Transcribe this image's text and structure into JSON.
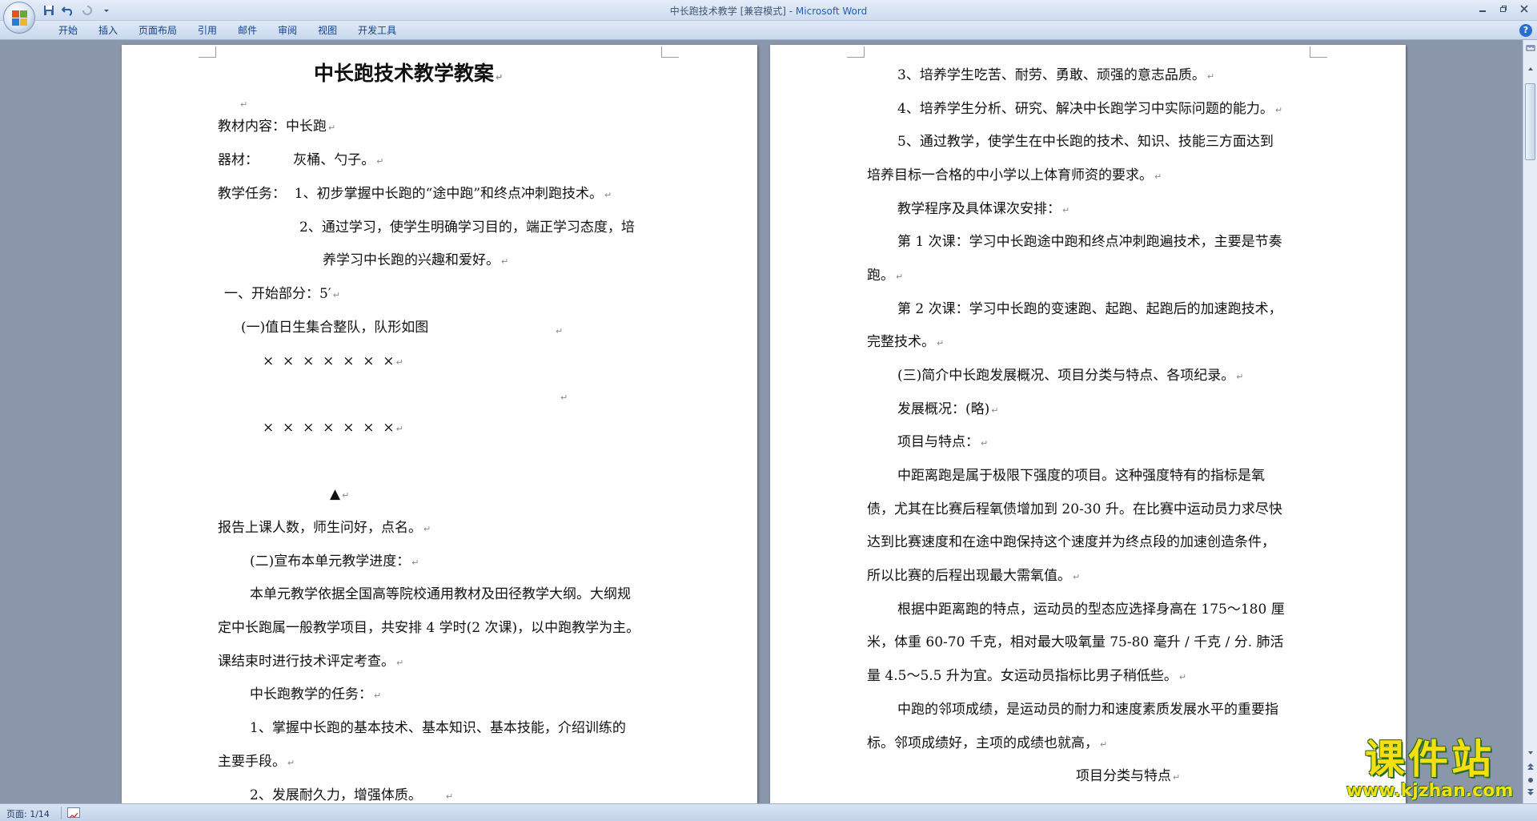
{
  "window": {
    "title_doc": "中长跑技术教学 [兼容模式] - ",
    "title_app": "Microsoft Word"
  },
  "quick_access": {
    "save_icon": "save-icon",
    "undo_icon": "undo-icon",
    "redo_icon": "redo-icon",
    "customize_icon": "dropdown-icon"
  },
  "ribbon": {
    "tabs": [
      "开始",
      "插入",
      "页面布局",
      "引用",
      "邮件",
      "审阅",
      "视图",
      "开发工具"
    ],
    "help": "?"
  },
  "left_page": {
    "title": "中长跑技术教学教案",
    "lines": [
      "教材内容：中长跑",
      "器材：        灰桶、勺子。",
      "教学任务：  1、初步掌握中长跑的“途中跑”和终点冲刺跑技术。",
      "2、通过学习，使学生明确学习目的，端正学习态度，培",
      "养学习中长跑的兴趣和爱好。",
      "一、开始部分：5′",
      "(一)值日生集合整队，队形如图",
      "×  ×  ×  ×  ×  ×  ×",
      "×  ×  ×  ×  ×  ×  ×",
      "▲",
      "报告上课人数，师生问好，点名。",
      "(二)宣布本单元教学进度：",
      "本单元教学依据全国高等院校通用教材及田径教学大纲。大纲规",
      "定中长跑属一般教学项目，共安排 4 学时(2 次课)，以中跑教学为主。",
      "课结束时进行技术评定考查。",
      "中长跑教学的任务：",
      "1、掌握中长跑的基本技术、基本知识、基本技能，介绍训练的",
      "主要手段。",
      "2、发展耐久力，增强体质。"
    ]
  },
  "right_page": {
    "lines": [
      "3、培养学生吃苦、耐劳、勇敢、顽强的意志品质。",
      "4、培养学生分析、研究、解决中长跑学习中实际问题的能力。",
      "5、通过教学，使学生在中长跑的技术、知识、技能三方面达到",
      "培养目标一合格的中小学以上体育师资的要求。",
      "教学程序及具体课次安排：",
      "第 1 次课：学习中长跑途中跑和终点冲刺跑遍技术，主要是节奏",
      "跑。",
      "第 2 次课：学习中长跑的变速跑、起跑、起跑后的加速跑技术，",
      "完整技术。",
      "(三)简介中长跑发展概况、项目分类与特点、各项纪录。",
      "发展概况：(略)",
      "项目与特点：",
      "中距离跑是属于极限下强度的项目。这种强度特有的指标是氧",
      "债，尤其在比赛后程氧债增加到 20-30 升。在比赛中运动员力求尽快",
      "达到比赛速度和在途中跑保持这个速度并为终点段的加速创造条件，",
      "所以比赛的后程出现最大需氧值。",
      "根据中距离跑的特点，运动员的型态应选择身高在 175～180 厘",
      "米，体重 60-70 千克，相对最大吸氧量 75-80 毫升 / 千克 / 分. 肺活",
      "量 4.5～5.5 升为宜。女运动员指标比男子稍低些。",
      "中跑的邻项成绩，是运动员的耐力和速度素质发展水平的重要指",
      "标。邻项成绩好，主项的成绩也就高，",
      "项目分类与特点"
    ]
  },
  "status": {
    "page": "页面: 1/14"
  },
  "watermark": {
    "main": "课件站",
    "url": "www.kjzhan.com"
  },
  "colors": {
    "ribbon_text": "#15428b",
    "workspace": "#8a97ab",
    "watermark_fill": "#f4e010"
  }
}
